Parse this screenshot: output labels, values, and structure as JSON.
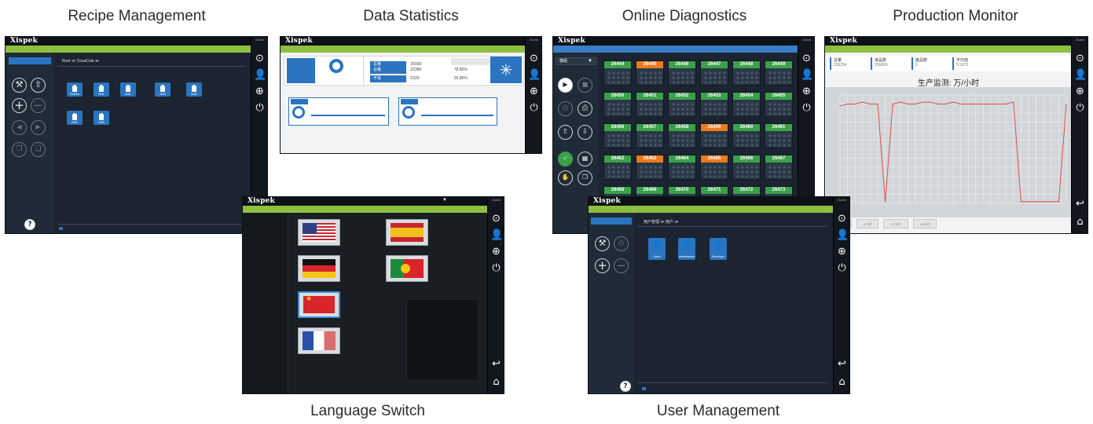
{
  "captions": {
    "recipe": "Recipe Management",
    "stats": "Data Statistics",
    "diag": "Online Diagnostics",
    "monitor": "Production Monitor",
    "language": "Language Switch",
    "user": "User Management"
  },
  "app": {
    "logo": "Xispek",
    "sidebar_user": "Guest"
  },
  "recipe": {
    "breadcrumb": "Root ≫ CocaCola ≫",
    "tiles": [
      "Preform",
      "Bot1",
      "Bot2",
      "Bot3",
      "Bot4",
      "Bot5",
      "Bot6"
    ]
  },
  "stats": {
    "table": [
      {
        "label": "总量",
        "value": "25000",
        "pct": ""
      },
      {
        "label": "合格",
        "value": "22380",
        "pct": "78.85%"
      },
      {
        "label": "不良",
        "value": "6320",
        "pct": "25.85%"
      }
    ]
  },
  "diag": {
    "select": "模组",
    "cells": [
      {
        "id": "26444",
        "status": "ok"
      },
      {
        "id": "26445",
        "status": "warn"
      },
      {
        "id": "26446",
        "status": "ok"
      },
      {
        "id": "26447",
        "status": "ok"
      },
      {
        "id": "26448",
        "status": "ok"
      },
      {
        "id": "26449",
        "status": "ok"
      },
      {
        "id": "26450",
        "status": "ok"
      },
      {
        "id": "26451",
        "status": "ok"
      },
      {
        "id": "26452",
        "status": "ok"
      },
      {
        "id": "26453",
        "status": "ok"
      },
      {
        "id": "26454",
        "status": "ok"
      },
      {
        "id": "26455",
        "status": "ok"
      },
      {
        "id": "26456",
        "status": "ok"
      },
      {
        "id": "26457",
        "status": "ok"
      },
      {
        "id": "26458",
        "status": "ok"
      },
      {
        "id": "26459",
        "status": "warn"
      },
      {
        "id": "26460",
        "status": "ok"
      },
      {
        "id": "26461",
        "status": "ok"
      },
      {
        "id": "26462",
        "status": "ok"
      },
      {
        "id": "26463",
        "status": "warn"
      },
      {
        "id": "26464",
        "status": "ok"
      },
      {
        "id": "26465",
        "status": "warn"
      },
      {
        "id": "26466",
        "status": "ok"
      },
      {
        "id": "26467",
        "status": "ok"
      },
      {
        "id": "26468",
        "status": "ok"
      },
      {
        "id": "26469",
        "status": "ok"
      },
      {
        "id": "26470",
        "status": "ok"
      },
      {
        "id": "26471",
        "status": "ok"
      },
      {
        "id": "26472",
        "status": "ok"
      },
      {
        "id": "26473",
        "status": "ok"
      }
    ]
  },
  "monitor": {
    "stats": [
      {
        "label": "总量",
        "value": "256294"
      },
      {
        "label": "良品数",
        "value": "256000"
      },
      {
        "label": "废品数",
        "value": "0"
      },
      {
        "label": "平均值",
        "value": "5.5673"
      }
    ],
    "chart_title": "生产监测: 万/小时",
    "buttons": [
      "1小时",
      "8小时",
      "12小时",
      "24小时"
    ]
  },
  "chart_data": {
    "type": "line",
    "title": "生产监测: 万/小时",
    "x": [
      0,
      1,
      2,
      3,
      4,
      5,
      6,
      7,
      8,
      9,
      10,
      11,
      12,
      13,
      14,
      15,
      16,
      17,
      18,
      19,
      20,
      21,
      22,
      23,
      24,
      25,
      26,
      27,
      28,
      29,
      30
    ],
    "series": [
      {
        "values": [
          5.4,
          5.5,
          5.5,
          5.6,
          5.5,
          5.5,
          0.1,
          5.5,
          5.6,
          5.5,
          5.5,
          5.6,
          5.6,
          5.5,
          5.5,
          5.6,
          5.5,
          5.5,
          5.5,
          5.5,
          5.5,
          5.5,
          5.5,
          5.6,
          0.1,
          0.1,
          0.1,
          0.1,
          0.1,
          0.1,
          5.5
        ]
      }
    ],
    "ylim": [
      0,
      6
    ],
    "color": "#e04a4a",
    "grid": true
  },
  "language": {
    "flags": [
      "us",
      "es",
      "de",
      "pt",
      "cn",
      "fr"
    ],
    "selected": "cn"
  },
  "user": {
    "breadcrumb": "用户管理 ≫ 用户 ≫",
    "users": [
      "Guest",
      "Administrator",
      "Developer"
    ]
  }
}
